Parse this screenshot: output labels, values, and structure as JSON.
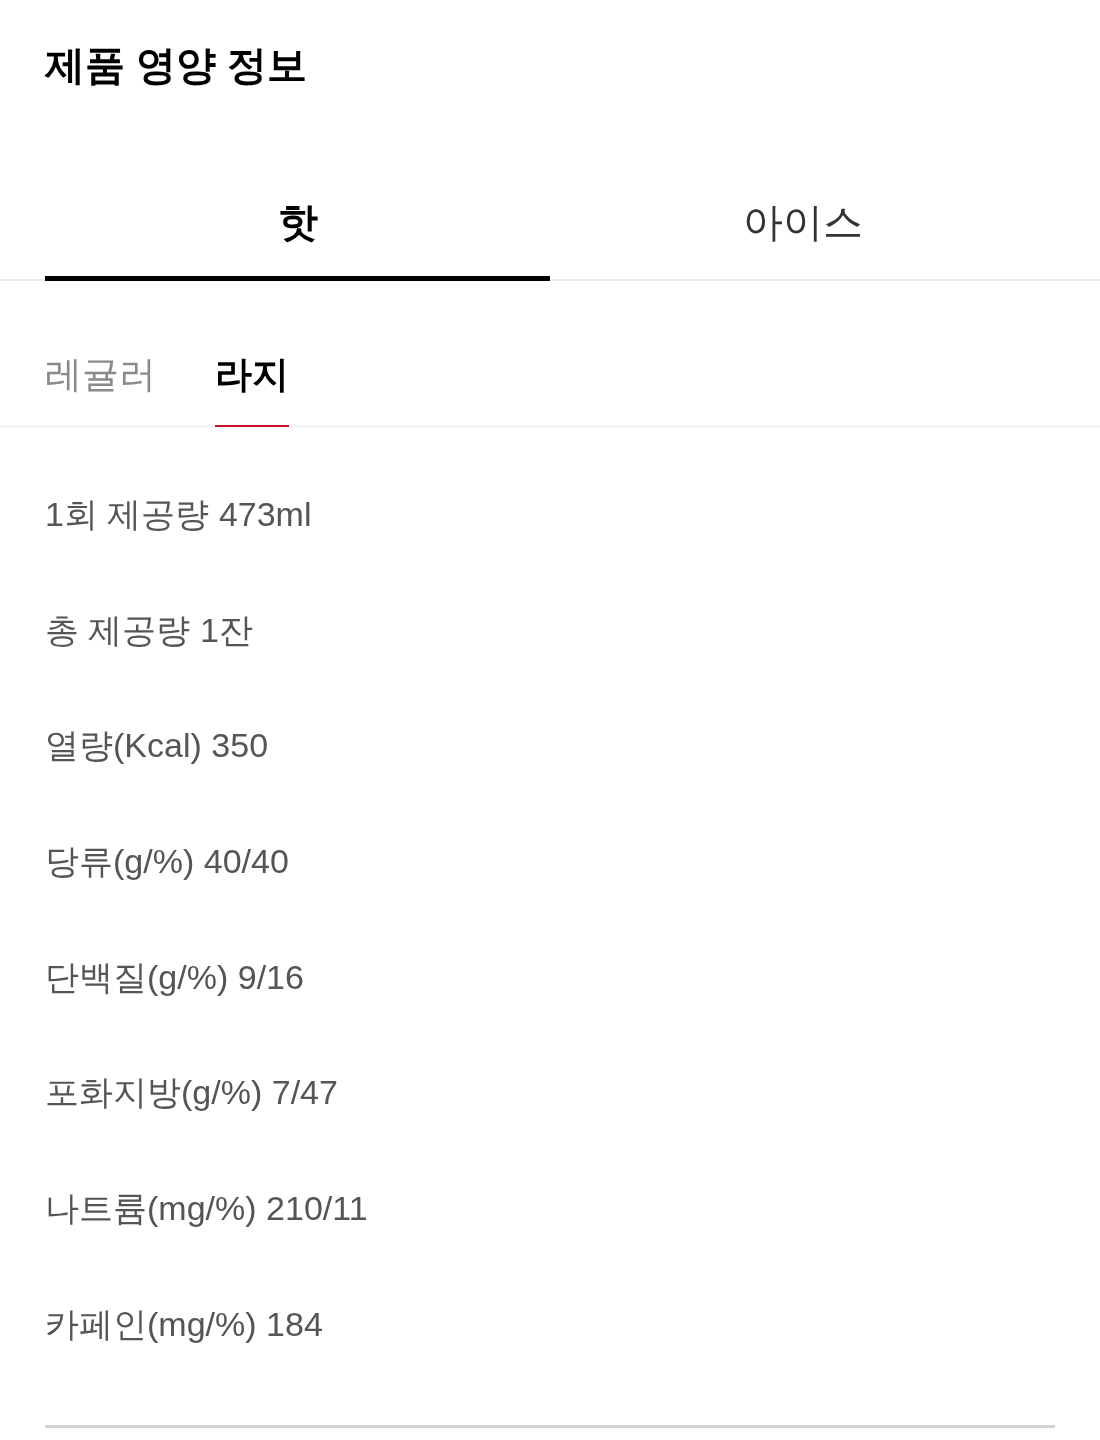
{
  "title": "제품 영양 정보",
  "temperature_tabs": [
    {
      "label": "핫",
      "selected": true
    },
    {
      "label": "아이스",
      "selected": false
    }
  ],
  "size_tabs": [
    {
      "label": "레귤러",
      "selected": false
    },
    {
      "label": "라지",
      "selected": true
    }
  ],
  "nutrition": [
    {
      "label": "1회 제공량",
      "value": "473ml"
    },
    {
      "label": "총 제공량",
      "value": "1잔"
    },
    {
      "label": "열량(Kcal)",
      "value": "350"
    },
    {
      "label": "당류(g/%)",
      "value": "40/40"
    },
    {
      "label": "단백질(g/%)",
      "value": "9/16"
    },
    {
      "label": "포화지방(g/%)",
      "value": "7/47"
    },
    {
      "label": "나트륨(mg/%)",
      "value": "210/11"
    },
    {
      "label": "카페인(mg/%)",
      "value": "184"
    }
  ]
}
